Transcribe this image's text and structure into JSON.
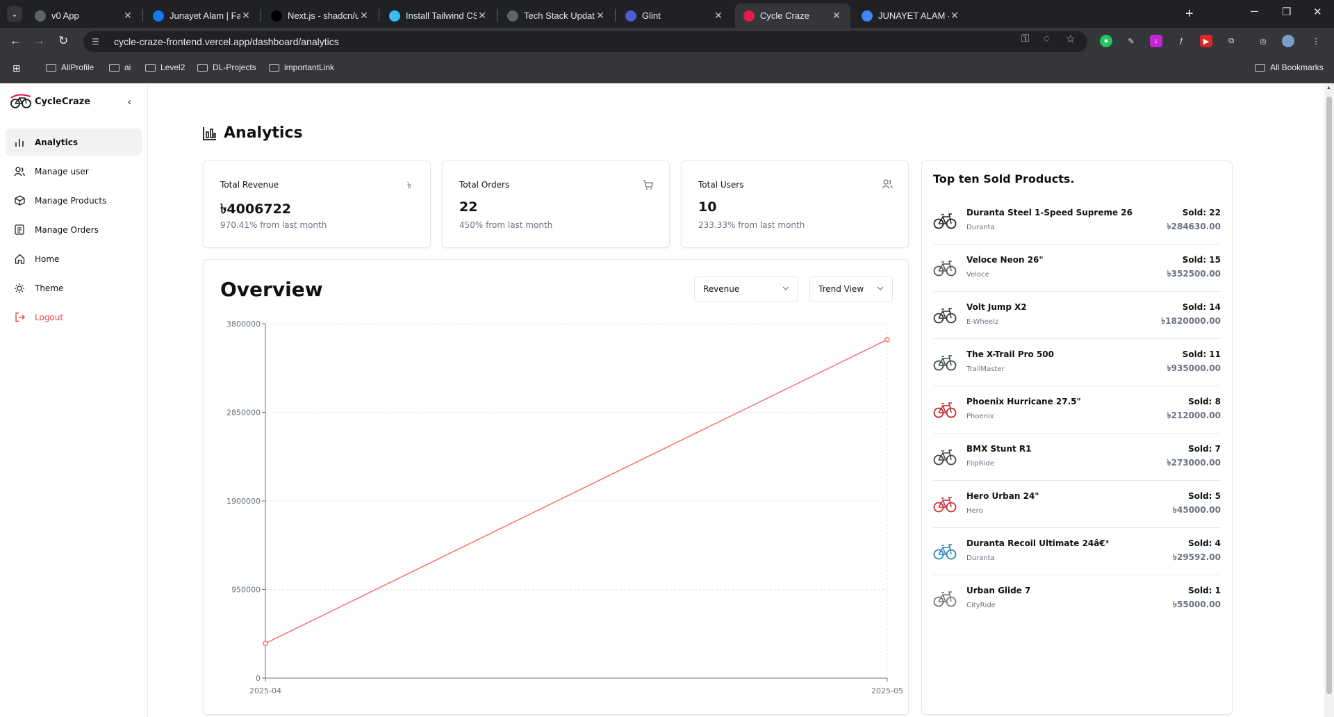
{
  "browser": {
    "tabs": [
      {
        "title": "v0 App",
        "favicon_color": "#5f6368",
        "active": false
      },
      {
        "title": "Junayet Alam | Facebook",
        "favicon_color": "#1877f2",
        "active": false
      },
      {
        "title": "Next.js - shadcn/ui",
        "favicon_color": "#000000",
        "active": false
      },
      {
        "title": "Install Tailwind CSS with N",
        "favicon_color": "#38bdf8",
        "active": false
      },
      {
        "title": "Tech Stack Update",
        "favicon_color": "#5f6368",
        "active": false
      },
      {
        "title": "Glint",
        "favicon_color": "#4f5bd5",
        "active": false
      },
      {
        "title": "Cycle Craze",
        "favicon_color": "#e11d48",
        "active": true
      },
      {
        "title": "JUNAYET ALAM - Google",
        "favicon_color": "#4285f4",
        "active": false
      }
    ],
    "url": "cycle-craze-frontend.vercel.app/dashboard/analytics",
    "bookmarks": [
      "AllProfile",
      "ai",
      "Level2",
      "DL-Projects",
      "importantLink"
    ],
    "all_bookmarks": "All Bookmarks"
  },
  "sidebar": {
    "brand": "CycleCraze",
    "items": [
      {
        "label": "Analytics",
        "icon": "bar-chart-icon",
        "active": true
      },
      {
        "label": "Manage user",
        "icon": "users-icon",
        "active": false
      },
      {
        "label": "Manage Products",
        "icon": "box-icon",
        "active": false
      },
      {
        "label": "Manage Orders",
        "icon": "orders-icon",
        "active": false
      },
      {
        "label": "Home",
        "icon": "home-icon",
        "active": false
      },
      {
        "label": "Theme",
        "icon": "sun-icon",
        "active": false
      },
      {
        "label": "Logout",
        "icon": "logout-icon",
        "active": false
      }
    ]
  },
  "main": {
    "title": "Analytics",
    "stats": [
      {
        "label": "Total Revenue",
        "value": "৳4006722",
        "delta": "970.41% from last month",
        "icon": "taka-icon"
      },
      {
        "label": "Total Orders",
        "value": "22",
        "delta": "450% from last month",
        "icon": "cart-icon"
      },
      {
        "label": "Total Users",
        "value": "10",
        "delta": "233.33% from last month",
        "icon": "users-icon"
      }
    ],
    "overview": {
      "title": "Overview",
      "metric_select": "Revenue",
      "view_select": "Trend View"
    },
    "top_products": {
      "title": "Top ten Sold Products.",
      "items": [
        {
          "name": "Duranta Steel 1-Speed Supreme 26",
          "brand": "Duranta",
          "sold": "Sold: 22",
          "amount": "৳284630.00",
          "color": "#222222"
        },
        {
          "name": "Veloce Neon 26\"",
          "brand": "Veloce",
          "sold": "Sold: 15",
          "amount": "৳352500.00",
          "color": "#555555"
        },
        {
          "name": "Volt Jump X2",
          "brand": "E-Wheelz",
          "sold": "Sold: 14",
          "amount": "৳1820000.00",
          "color": "#333333"
        },
        {
          "name": "The X-Trail Pro 500",
          "brand": "TrailMaster",
          "sold": "Sold: 11",
          "amount": "৳935000.00",
          "color": "#3b4a3f"
        },
        {
          "name": "Phoenix Hurricane 27.5\"",
          "brand": "Phoenix",
          "sold": "Sold: 8",
          "amount": "৳212000.00",
          "color": "#c0262d"
        },
        {
          "name": "BMX Stunt R1",
          "brand": "FlipRide",
          "sold": "Sold: 7",
          "amount": "৳273000.00",
          "color": "#444444"
        },
        {
          "name": "Hero Urban 24\"",
          "brand": "Hero",
          "sold": "Sold: 5",
          "amount": "৳45000.00",
          "color": "#d12f35"
        },
        {
          "name": "Duranta Recoil Ultimate 24â€³",
          "brand": "Duranta",
          "sold": "Sold: 4",
          "amount": "৳29592.00",
          "color": "#2a86b8"
        },
        {
          "name": "Urban Glide 7",
          "brand": "CityRide",
          "sold": "Sold: 1",
          "amount": "৳55000.00",
          "color": "#777777"
        }
      ]
    }
  },
  "chart_data": {
    "type": "line",
    "x": [
      "2025-04",
      "2025-05"
    ],
    "series": [
      {
        "values": [
          372000,
          3630000
        ],
        "color": "#f87171"
      }
    ],
    "yticks": [
      0,
      950000,
      1900000,
      2850000,
      3800000
    ],
    "ylim": [
      0,
      3800000
    ],
    "grid": true
  }
}
